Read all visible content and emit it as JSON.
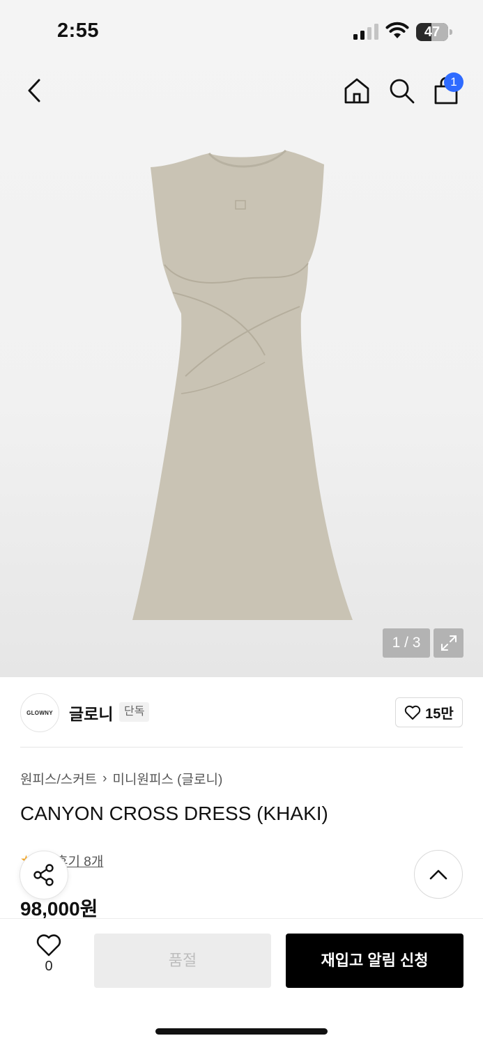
{
  "status_bar": {
    "time": "2:55",
    "battery_percent": "47",
    "battery_level": 0.47
  },
  "nav": {
    "back_icon": "chevron-left-icon",
    "home_icon": "home-icon",
    "search_icon": "search-icon",
    "cart_icon": "shopping-bag-icon",
    "cart_count": "1",
    "badge_color": "#2f6bff"
  },
  "gallery": {
    "indicator": "1 / 3",
    "expand_icon": "expand-icon",
    "image": "khaki sleeveless cross dress",
    "dress_color": "#c9c3b4"
  },
  "brand": {
    "logo_text": "GLOWNY",
    "name": "글로니",
    "badge": "단독",
    "likes": "15만"
  },
  "breadcrumb": {
    "category": "원피스/스커트",
    "separator": "›",
    "subcategory": "미니원피스 (글로니)"
  },
  "product": {
    "title": "CANYON CROSS DRESS (KHAKI)",
    "review_label": "후기 8개",
    "price": "98,000원"
  },
  "bottom": {
    "wish_count": "0",
    "soldout_label": "품절",
    "restock_label": "재입고 알림 신청"
  }
}
